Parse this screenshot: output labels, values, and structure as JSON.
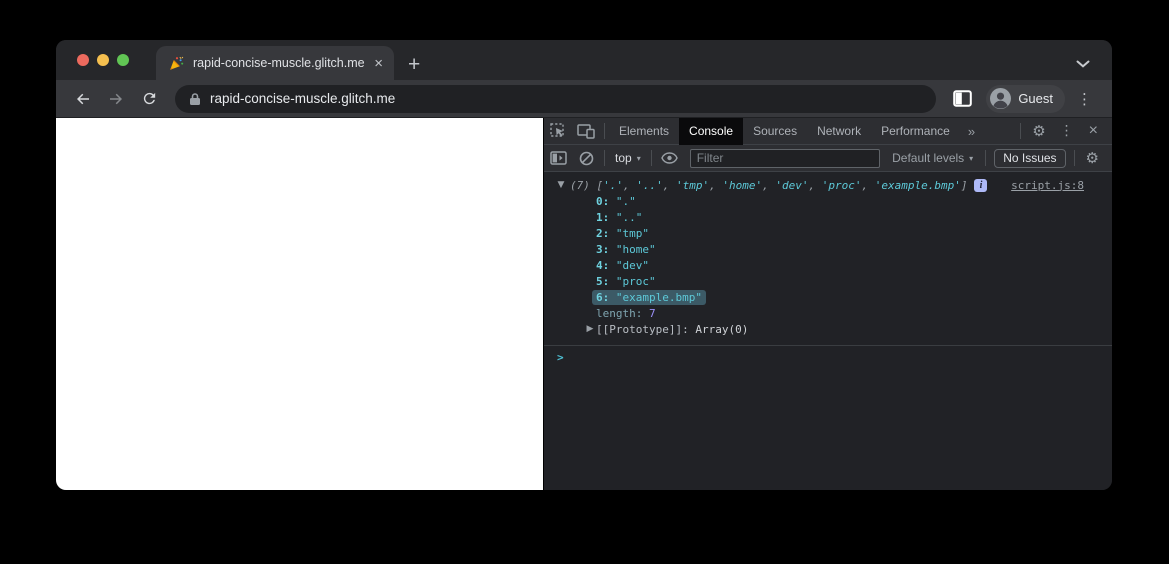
{
  "colors": {
    "traffic_red": "#ec6a5e",
    "traffic_yellow": "#f5bf4f",
    "traffic_green": "#61c554",
    "string_teal": "#5dc9d8",
    "index_teal": "#6fd3e0",
    "muted_teal": "#7fa5b0",
    "number_violet": "#9a8ff7",
    "highlight": "#3c5a66",
    "badge_bg": "#aeb9f7",
    "prompt_teal": "#4ec0d4"
  },
  "browser": {
    "tab_title": "rapid-concise-muscle.glitch.me",
    "tab_close": "×",
    "new_tab_button": "+",
    "url": "rapid-concise-muscle.glitch.me",
    "guest_label": "Guest",
    "kebab": "⋮"
  },
  "devtools": {
    "panel_tabs": [
      {
        "label": "Elements"
      },
      {
        "label": "Console"
      },
      {
        "label": "Sources"
      },
      {
        "label": "Network"
      },
      {
        "label": "Performance"
      }
    ],
    "more_tabs": "»",
    "gear": "⚙",
    "kebab": "⋮",
    "close": "×",
    "toolbar": {
      "context_selector": "top",
      "caret": "▾",
      "filter_placeholder": "Filter",
      "levels_selector": "Default levels",
      "issues_button": "No Issues"
    },
    "console": {
      "expand_caret": "▼",
      "collapse_caret": "▶",
      "count": "(7)",
      "open_bracket": " [",
      "close_bracket": "]",
      "separator": ", ",
      "preview_items": [
        "'.'",
        "'..'",
        "'tmp'",
        "'home'",
        "'dev'",
        "'proc'",
        "'example.bmp'"
      ],
      "info_badge": "i",
      "source_link": "script.js:8",
      "entries": [
        {
          "index": "0:",
          "value": "\".\"",
          "highlighted": false
        },
        {
          "index": "1:",
          "value": "\"..\"",
          "highlighted": false
        },
        {
          "index": "2:",
          "value": "\"tmp\"",
          "highlighted": false
        },
        {
          "index": "3:",
          "value": "\"home\"",
          "highlighted": false
        },
        {
          "index": "4:",
          "value": "\"dev\"",
          "highlighted": false
        },
        {
          "index": "5:",
          "value": "\"proc\"",
          "highlighted": false
        },
        {
          "index": "6:",
          "value": "\"example.bmp\"",
          "highlighted": true
        }
      ],
      "length_label": "length:",
      "length_value": "7",
      "prototype_label": "[[Prototype]]:",
      "prototype_value": "Array(0)",
      "prompt": ">"
    }
  }
}
